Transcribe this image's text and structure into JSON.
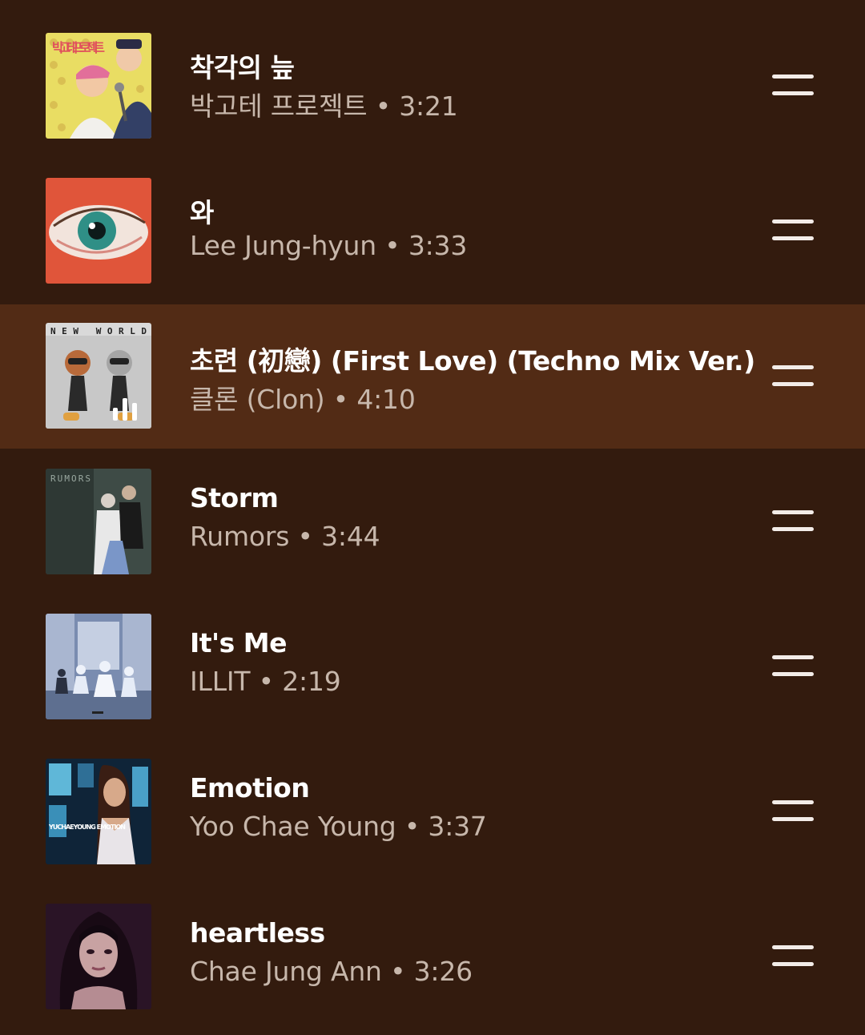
{
  "queue": {
    "colors": {
      "background": "#331b0e",
      "playing_background": "#522b15",
      "title": "#ffffff",
      "subtitle": "#c7b7ab"
    },
    "tracks": [
      {
        "title": "착각의 늪",
        "subtitle": "박고테 프로젝트 • 3:21",
        "art_text": "박고테 프로젝트",
        "playing": false,
        "handle_icon": "drag-handle-icon"
      },
      {
        "title": "와",
        "subtitle": "Lee Jung-hyun • 3:33",
        "playing": false,
        "handle_icon": "drag-handle-icon"
      },
      {
        "title": "초련 (初戀) (First Love) (Techno Mix Ver.)",
        "subtitle": "클론 (Clon) • 4:10",
        "art_text": "NEW WORLD",
        "playing": true,
        "now_playing_icon": "equalizer-icon",
        "handle_icon": "drag-handle-icon"
      },
      {
        "title": "Storm",
        "subtitle": "Rumors • 3:44",
        "art_text": "RUMORS",
        "playing": false,
        "handle_icon": "drag-handle-icon"
      },
      {
        "title": "It's Me",
        "subtitle": "ILLIT • 2:19",
        "playing": false,
        "handle_icon": "drag-handle-icon"
      },
      {
        "title": "Emotion",
        "subtitle": "Yoo Chae Young • 3:37",
        "art_text": "YUCHAEYOUNG EMOTION",
        "playing": false,
        "handle_icon": "drag-handle-icon"
      },
      {
        "title": "heartless",
        "subtitle": "Chae Jung Ann • 3:26",
        "playing": false,
        "handle_icon": "drag-handle-icon"
      }
    ]
  }
}
